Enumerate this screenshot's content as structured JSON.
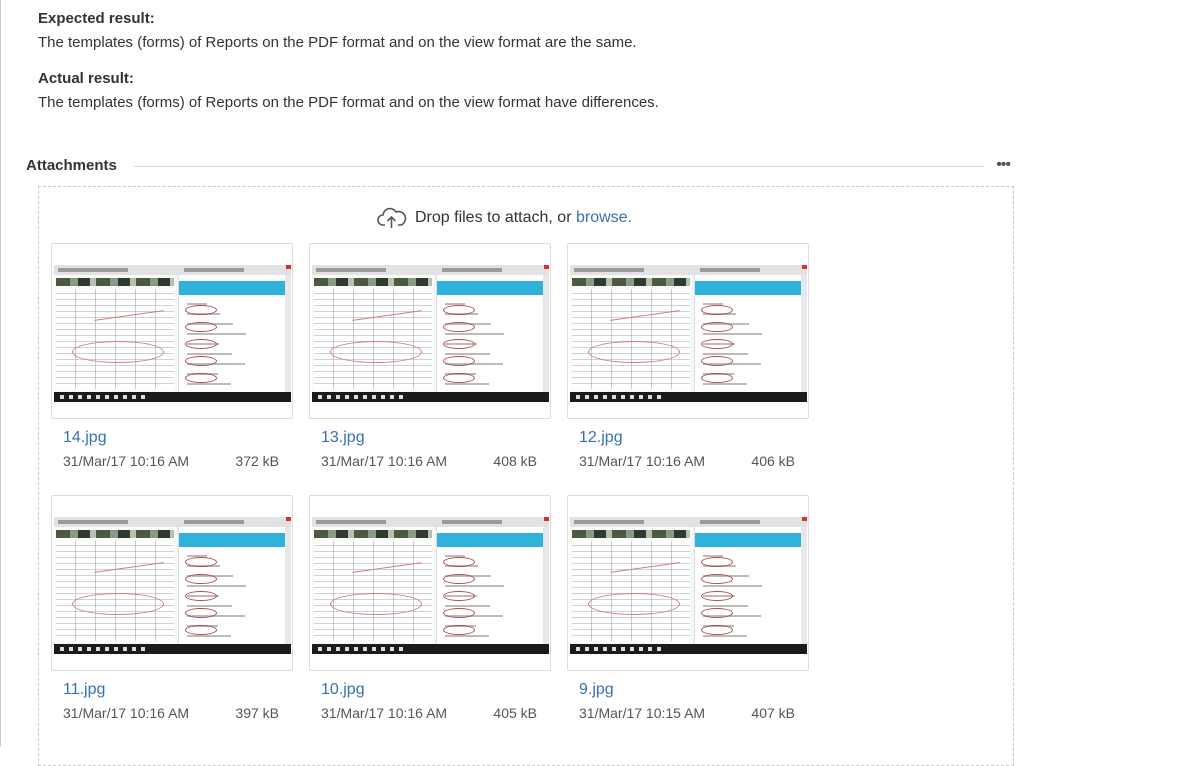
{
  "expected": {
    "heading": "Expected result:",
    "text": "The templates (forms) of Reports on the PDF format and on the view format are the same."
  },
  "actual": {
    "heading": "Actual result:",
    "text": "The templates (forms) of Reports on the PDF format and on the view format have differences."
  },
  "attachments": {
    "title": "Attachments",
    "more_label": "•••",
    "drop_text": "Drop files to attach, or",
    "browse_label": "browse.",
    "files": [
      {
        "name": "14.jpg",
        "date": "31/Mar/17 10:16 AM",
        "size": "372 kB"
      },
      {
        "name": "13.jpg",
        "date": "31/Mar/17 10:16 AM",
        "size": "408 kB"
      },
      {
        "name": "12.jpg",
        "date": "31/Mar/17 10:16 AM",
        "size": "406 kB"
      },
      {
        "name": "11.jpg",
        "date": "31/Mar/17 10:16 AM",
        "size": "397 kB"
      },
      {
        "name": "10.jpg",
        "date": "31/Mar/17 10:16 AM",
        "size": "405 kB"
      },
      {
        "name": "9.jpg",
        "date": "31/Mar/17 10:15 AM",
        "size": "407 kB"
      }
    ]
  },
  "colors": {
    "link": "#3572b0",
    "accent_bar": "#31b2dd",
    "annotation": "#d97a7a"
  },
  "icons": {
    "upload": "cloud-upload-icon",
    "more": "more-horizontal-icon"
  }
}
